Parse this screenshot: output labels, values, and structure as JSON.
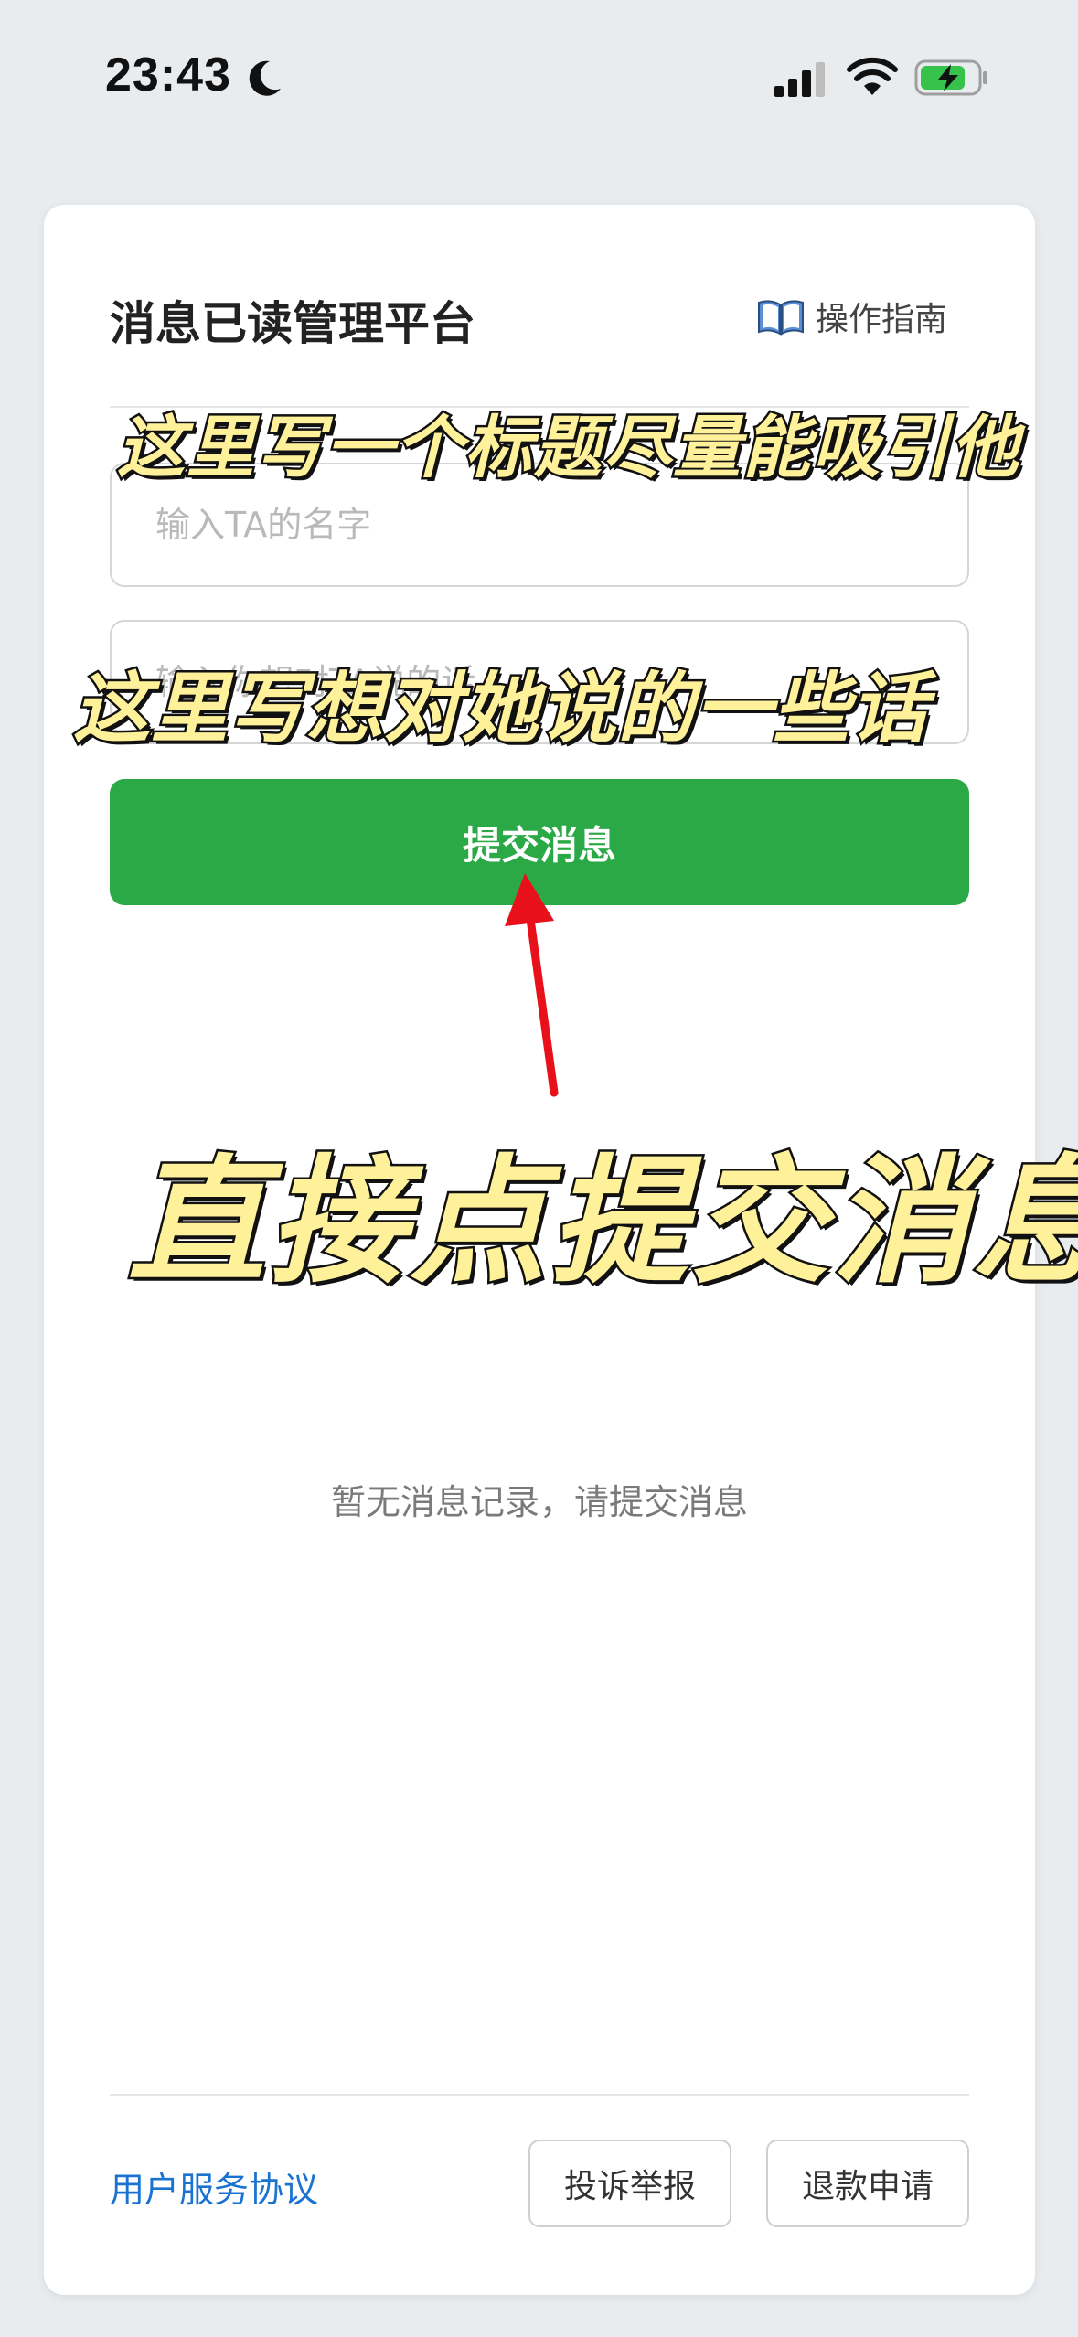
{
  "status_bar": {
    "time": "23:43",
    "icons": [
      "moon-icon",
      "signal-icon",
      "wifi-icon",
      "battery-charging-icon"
    ]
  },
  "header": {
    "title": "消息已读管理平台",
    "guide_label": "操作指南",
    "guide_icon": "book-icon"
  },
  "form": {
    "name_placeholder": "输入TA的名字",
    "message_placeholder": "输入你想对TA说的话",
    "submit_label": "提交消息"
  },
  "empty_state": "暂无消息记录，请提交消息",
  "footer": {
    "agreement_label": "用户服务协议",
    "complaint_label": "投诉举报",
    "refund_label": "退款申请"
  },
  "annotations": {
    "title_hint": "这里写一个标题尽量能吸引他",
    "message_hint": "这里写想对她说的一些话",
    "submit_hint": "直接点提交消息"
  },
  "colors": {
    "primary_green": "#2aa946",
    "link_blue": "#1b73d1",
    "annotation_yellow": "#fff09a",
    "arrow_red": "#e8101b"
  }
}
